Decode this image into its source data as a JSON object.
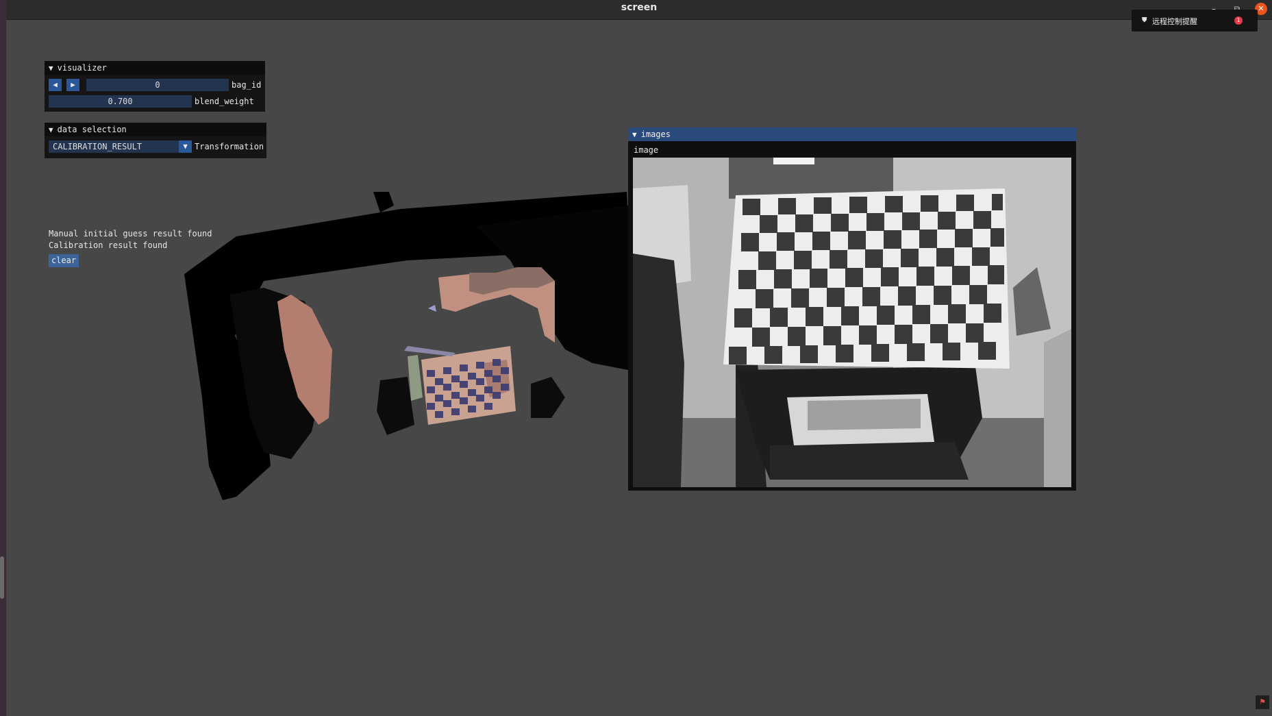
{
  "window": {
    "title": "screen",
    "minimize": "–",
    "restore": "⧉",
    "close": "✕"
  },
  "notification": {
    "text": "远程控制提醒",
    "count": "1"
  },
  "visualizer": {
    "title": "visualizer",
    "prev_icon": "◀",
    "next_icon": "▶",
    "bag_id_value": "0",
    "bag_id_label": "bag_id",
    "blend_weight_value": "0.700",
    "blend_weight_label": "blend_weight"
  },
  "data_selection": {
    "title": "data selection",
    "selected": "CALIBRATION_RESULT",
    "label": "Transformation"
  },
  "status": {
    "line1": "Manual initial guess result found",
    "line2": "Calibration result found",
    "clear_label": "clear"
  },
  "images": {
    "title": "images",
    "caption": "image"
  },
  "colors": {
    "background": "#474747",
    "header_active": "#294a7a",
    "button": "#2a5798",
    "field": "#22344f"
  }
}
